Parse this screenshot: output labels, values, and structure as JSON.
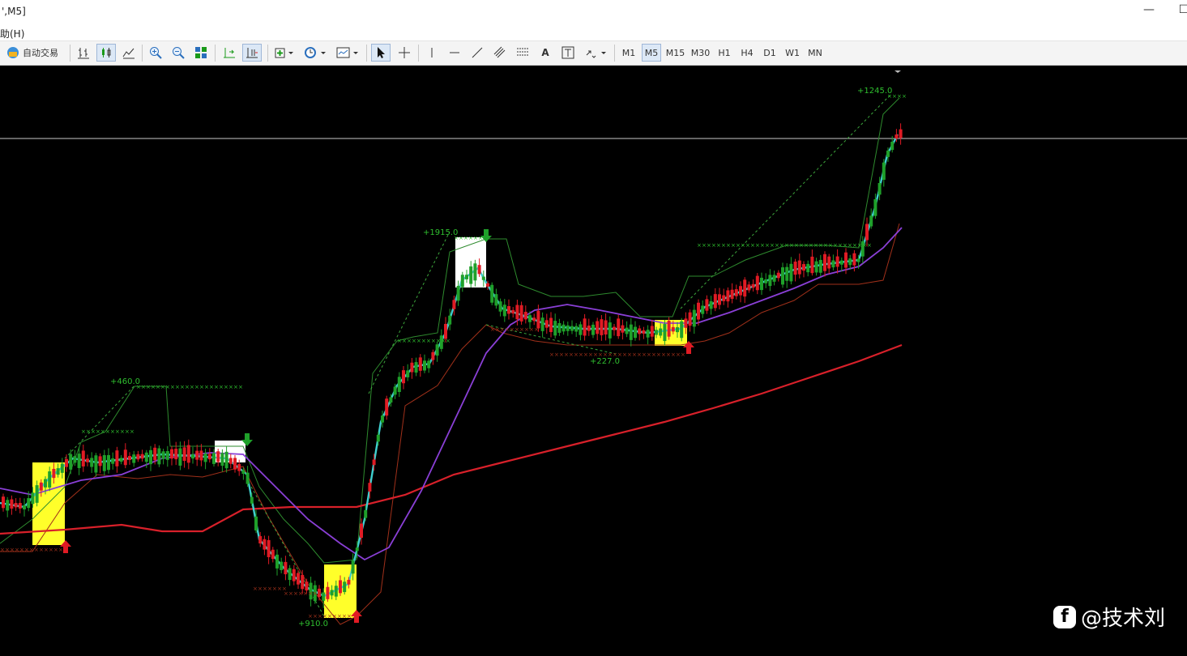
{
  "window": {
    "title": "',M5]",
    "min_glyph": "—",
    "max_glyph": "☐"
  },
  "menu": {
    "help": "助(H)"
  },
  "toolbar": {
    "autotrade_label": "自动交易",
    "icons": [
      "bar-chart-icon",
      "candlestick-icon",
      "line-chart-icon",
      "zoom-in-icon",
      "zoom-out-icon",
      "tile-windows-icon",
      "chart-shift-icon",
      "autoscroll-icon",
      "indicators-icon",
      "periods-icon",
      "templates-icon",
      "cursor-icon",
      "crosshair-icon",
      "vertical-line-icon",
      "horizontal-line-icon",
      "trendline-icon",
      "equidistant-channel-icon",
      "fibonacci-icon",
      "text-icon",
      "text-label-icon",
      "arrows-icon"
    ],
    "timeframes": [
      "M1",
      "M5",
      "M15",
      "M30",
      "H1",
      "H4",
      "D1",
      "W1",
      "MN"
    ],
    "active_timeframe": "M5",
    "text_tool": "A"
  },
  "chart": {
    "labels": {
      "l460": "+460.0",
      "l910": "+910.0",
      "l1915": "+1915.0",
      "l227": "+227.0",
      "l1245": "+1245.0"
    },
    "colors": {
      "bull": "#e01b24",
      "bear": "#1fa02a",
      "cyan": "#3fd0d0",
      "purple": "#8a3fd6",
      "red_ma": "#d8202a",
      "green_channel": "#2e8b2e",
      "brown_channel": "#a0301a",
      "yellow_box": "#ffff2a",
      "white_box": "#ffffff",
      "label_green": "#2fbf2f"
    }
  },
  "watermark": {
    "text": "@技术刘"
  }
}
